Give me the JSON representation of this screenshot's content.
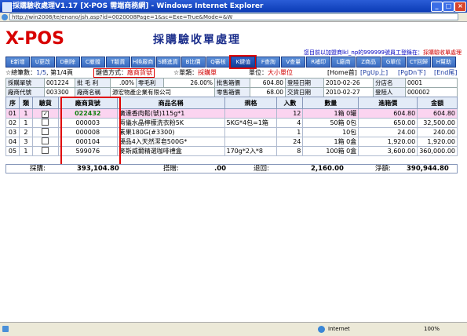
{
  "window": {
    "title": "採購驗收處理V1.17 [X-POS 需端商務網] - Windows Internet Explorer",
    "url": "http://win2008/te/enano/jsh.asp?id=0020008Page=1&sc=Exe=True&Mode=&W"
  },
  "app": {
    "logo": "X-POS",
    "page_title": "採購驗收單處理",
    "status_prefix": "您目前以加盟商lkl_np的999999號員工登錄在：",
    "status_page": "採購驗收單處理"
  },
  "toolbar": [
    {
      "label": "E新增",
      "active": false
    },
    {
      "label": "U更改",
      "active": false
    },
    {
      "label": "D刪除",
      "active": false
    },
    {
      "label": "C撤擋",
      "active": false
    },
    {
      "label": "T驗貨",
      "active": false
    },
    {
      "label": "H換廠商",
      "active": false
    },
    {
      "label": "S轉進貨",
      "active": false
    },
    {
      "label": "B比價",
      "active": false
    },
    {
      "label": "Q審核",
      "active": false
    },
    {
      "label": "K鍵值",
      "active": true
    },
    {
      "label": "F查詢",
      "active": false
    },
    {
      "label": "V查量",
      "active": false
    },
    {
      "label": "R補印",
      "active": false
    },
    {
      "label": "L廠商",
      "active": false
    },
    {
      "label": "Z商品",
      "active": false
    },
    {
      "label": "G單位",
      "active": false
    },
    {
      "label": "CT回歸",
      "active": false
    },
    {
      "label": "H幫助",
      "active": false
    }
  ],
  "info": {
    "total_label": "☆總筆數：",
    "total_value": "1/5",
    "page_label": "第1/4頁",
    "key_label": "鍵值方式：",
    "key_value": "廠商貨號",
    "type_label": "☆單類：",
    "type_value": "採購單",
    "unit_label": "單位：",
    "unit_value": "大小單位",
    "nav": [
      "[Home首]",
      "[PgUp上]",
      "[PgDn下]",
      "[End尾]"
    ]
  },
  "header": {
    "row1": [
      "採購單號",
      "001224",
      "批 毛 利",
      ".00%",
      "零毛利",
      "26.00%",
      "批售箱價",
      "604.80",
      "登陸日期",
      "2010-02-26",
      "分店名",
      "0001"
    ],
    "row2": [
      "廠商代號",
      "003300",
      "廠商名稱",
      "源宏物產企業有限公司",
      "零售箱價",
      "68.00",
      "交貨日期",
      "2010-02-27",
      "登陸人",
      "000002"
    ]
  },
  "grid": {
    "columns": [
      "序",
      "類",
      "驗貨",
      "廠商貨號",
      "商品名稱",
      "規格",
      "入數",
      "數量",
      "進箱價",
      "金額"
    ],
    "rows": [
      {
        "seq": "01",
        "cls": "1",
        "chk": true,
        "code": "022432",
        "name": "廣達香肉鬆(號)115g*1",
        "spec": "",
        "per": "12",
        "qty": "1箱 0罐",
        "price": "604.80",
        "amount": "604.80",
        "sel": true
      },
      {
        "seq": "02",
        "cls": "1",
        "chk": false,
        "code": "000003",
        "name": "兩儀水晶檸檬洗衣粉5K",
        "spec": "5KG*4包=1箱",
        "per": "4",
        "qty": "50箱 0包",
        "price": "650.00",
        "amount": "32,500.00",
        "sel": false
      },
      {
        "seq": "03",
        "cls": "2",
        "chk": false,
        "code": "000008",
        "name": "素果180G(#3300)",
        "spec": "",
        "per": "1",
        "qty": "10包",
        "price": "24.00",
        "amount": "240.00",
        "sel": false
      },
      {
        "seq": "04",
        "cls": "3",
        "chk": false,
        "code": "000104",
        "name": "優品4入天然潔皂500G*",
        "spec": "",
        "per": "24",
        "qty": "1箱 0盒",
        "price": "1,920.00",
        "amount": "1,920.00",
        "sel": false
      },
      {
        "seq": "05",
        "cls": "1",
        "chk": false,
        "code": "599076",
        "name": "麥斯威爾精選咖啡禮盒",
        "spec": "170g*2入*8",
        "per": "8",
        "qty": "100箱 0盒",
        "price": "3,600.00",
        "amount": "360,000.00",
        "sel": false
      }
    ]
  },
  "totals": {
    "purchase_label": "採購:",
    "purchase_value": "393,104.80",
    "discount_label": "搭贈:",
    "discount_value": ".00",
    "return_label": "退回:",
    "return_value": "2,160.00",
    "net_label": "淨額:",
    "net_value": "390,944.80"
  },
  "statusbar": {
    "zone": "Internet",
    "zoom": "100%"
  }
}
